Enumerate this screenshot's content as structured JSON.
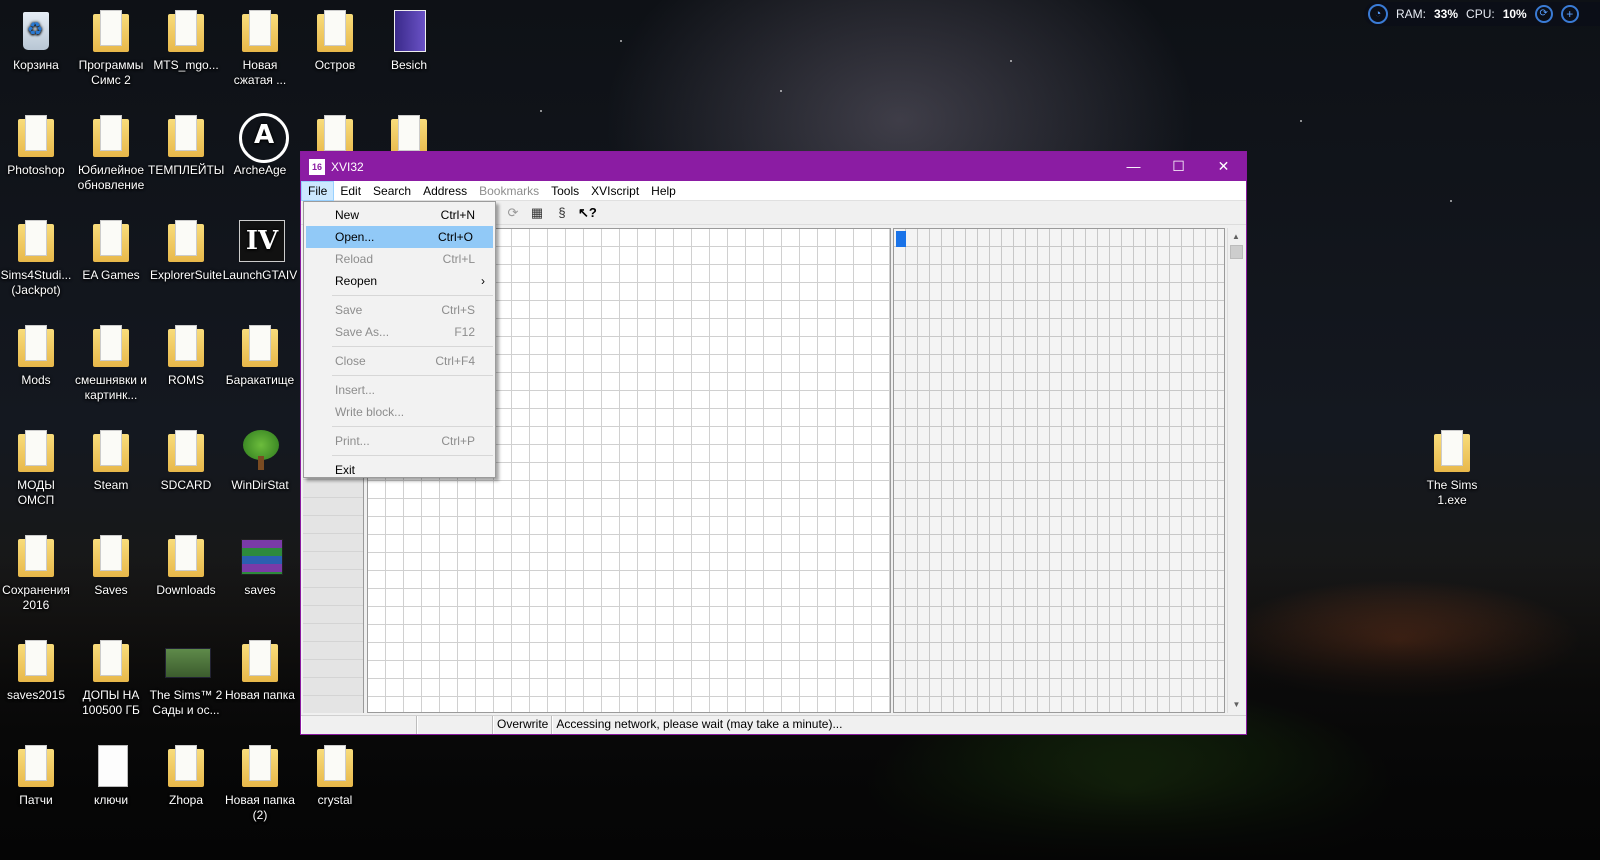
{
  "desktop": {
    "icons": [
      {
        "label": "Корзина",
        "icon": "recycle-bin-icon"
      },
      {
        "label": "Программы Симс 2",
        "icon": "folder-icon"
      },
      {
        "label": "MTS_mgo...",
        "icon": "folder-icon"
      },
      {
        "label": "Новая сжатая ...",
        "icon": "zip-folder-icon"
      },
      {
        "label": "Остров",
        "icon": "folder-icon"
      },
      {
        "label": "Besich",
        "icon": "book-icon"
      },
      {
        "label": "Photoshop",
        "icon": "folder-icon"
      },
      {
        "label": "Юбилейное обновление",
        "icon": "folder-icon"
      },
      {
        "label": "ТЕМПЛЕЙТЫ",
        "icon": "folder-icon"
      },
      {
        "label": "ArcheAge",
        "icon": "archeage-icon"
      },
      {
        "label": "Sims4Studi... (Jackpot)",
        "icon": "folder-icon"
      },
      {
        "label": "EA Games",
        "icon": "folder-icon"
      },
      {
        "label": "ExplorerSuite",
        "icon": "folder-icon"
      },
      {
        "label": "LaunchGTAIV",
        "icon": "gta-iv-icon"
      },
      {
        "label": "Mods",
        "icon": "folder-icon"
      },
      {
        "label": "смешнявки и картинк...",
        "icon": "folder-icon"
      },
      {
        "label": "ROMS",
        "icon": "folder-icon"
      },
      {
        "label": "Баракатище",
        "icon": "folder-icon"
      },
      {
        "label": "МОДЫ ОМСП",
        "icon": "folder-icon"
      },
      {
        "label": "Steam",
        "icon": "folder-icon"
      },
      {
        "label": "SDCARD",
        "icon": "folder-icon"
      },
      {
        "label": "WinDirStat",
        "icon": "windirstat-icon"
      },
      {
        "label": "Сохранения 2016",
        "icon": "folder-icon"
      },
      {
        "label": "Saves",
        "icon": "folder-icon"
      },
      {
        "label": "Downloads",
        "icon": "folder-icon"
      },
      {
        "label": "saves",
        "icon": "winrar-icon"
      },
      {
        "label": "saves2015",
        "icon": "folder-icon"
      },
      {
        "label": "ДОПЫ НА 100500 ГБ",
        "icon": "folder-icon"
      },
      {
        "label": "The Sims™ 2 Сады и ос...",
        "icon": "game-shortcut-icon"
      },
      {
        "label": "Новая папка",
        "icon": "folder-icon"
      },
      {
        "label": "Патчи",
        "icon": "folder-icon"
      },
      {
        "label": "ключи",
        "icon": "file-icon"
      },
      {
        "label": "Zhopa",
        "icon": "folder-icon"
      },
      {
        "label": "Новая папка (2)",
        "icon": "folder-icon"
      },
      {
        "label": "crystal",
        "icon": "folder-icon"
      },
      {
        "label": "The Sims 1.exe",
        "icon": "folder-icon"
      }
    ]
  },
  "tray": {
    "ram_label": "RAM:",
    "ram_value": "33%",
    "cpu_label": "CPU:",
    "cpu_value": "10%"
  },
  "window": {
    "title": "XVI32",
    "app_icon": "xvi32-icon",
    "controls": {
      "minimize": "—",
      "maximize": "☐",
      "close": "✕"
    },
    "menu": [
      "File",
      "Edit",
      "Search",
      "Address",
      "Bookmarks",
      "Tools",
      "XVIscript",
      "Help"
    ],
    "toolbar_icons": [
      "find-next-icon",
      "properties-icon",
      "script-icon",
      "context-help-icon"
    ],
    "status": {
      "mode": "Overwrite",
      "message": "Accessing network, please wait (may take a minute)..."
    }
  },
  "file_menu": {
    "items": [
      {
        "label": "New",
        "shortcut": "Ctrl+N",
        "enabled": true
      },
      {
        "label": "Open...",
        "shortcut": "Ctrl+O",
        "enabled": true,
        "highlighted": true
      },
      {
        "label": "Reload",
        "shortcut": "Ctrl+L",
        "enabled": false
      },
      {
        "label": "Reopen",
        "shortcut": "",
        "enabled": true,
        "submenu": true
      },
      {
        "label": "Save",
        "shortcut": "Ctrl+S",
        "enabled": false
      },
      {
        "label": "Save As...",
        "shortcut": "F12",
        "enabled": false
      },
      {
        "label": "Close",
        "shortcut": "Ctrl+F4",
        "enabled": false
      },
      {
        "label": "Insert...",
        "shortcut": "",
        "enabled": false
      },
      {
        "label": "Write block...",
        "shortcut": "",
        "enabled": false
      },
      {
        "label": "Print...",
        "shortcut": "Ctrl+P",
        "enabled": false
      },
      {
        "label": "Exit",
        "shortcut": "",
        "enabled": true
      }
    ]
  }
}
